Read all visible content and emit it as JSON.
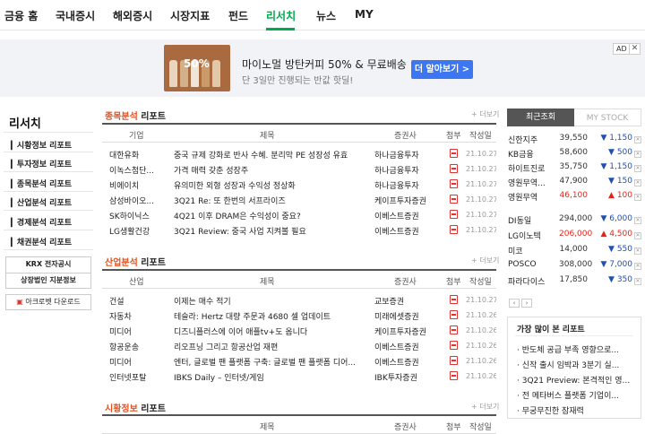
{
  "nav": {
    "tabs": [
      "금융 홈",
      "국내증시",
      "해외증시",
      "시장지표",
      "펀드",
      "리서치",
      "뉴스",
      "MY"
    ]
  },
  "ad": {
    "image_text": "50%",
    "title": "마이노멀 방탄커피 50% & 무료배송",
    "subtitle": "단 3일만 진행되는 반값 핫딜!",
    "button": "더 알아보기 >",
    "badge": "AD",
    "close": "✕"
  },
  "sidebar": {
    "title": "리서치",
    "items": [
      "시황정보 리포트",
      "투자정보 리포트",
      "종목분석 리포트",
      "산업분석 리포트",
      "경제분석 리포트",
      "채권분석 리포트"
    ],
    "links": [
      "KRX 전자공시",
      "상장법인 지분정보",
      "아크로벳 다운로드"
    ]
  },
  "sections": [
    {
      "title_hl": "종목분석",
      "title_rest": " 리포트",
      "more": "+ 더보기",
      "headers": [
        "기업",
        "제목",
        "증권사",
        "첨부",
        "작성일"
      ],
      "rows": [
        [
          "대한유화",
          "중국 규제 강화로 반사 수혜. 분리막 PE 성장성 유효",
          "하나금융투자",
          "21.10.27"
        ],
        [
          "이녹스첨단...",
          "가격 매력 갖춘 성장주",
          "하나금융투자",
          "21.10.27"
        ],
        [
          "비에이치",
          "유의미한 외형 성장과 수익성 정상화",
          "하나금융투자",
          "21.10.27"
        ],
        [
          "삼성바이오...",
          "3Q21 Re: 또 한번의 서프라이즈",
          "케이프투자증권",
          "21.10.27"
        ],
        [
          "SK하이닉스",
          "4Q21 이후 DRAM은 수익성이 중요?",
          "이베스트증권",
          "21.10.27"
        ],
        [
          "LG생활건강",
          "3Q21 Review: 중국 사업 지켜볼 필요",
          "이베스트증권",
          "21.10.27"
        ]
      ]
    },
    {
      "title_hl": "산업분석",
      "title_rest": " 리포트",
      "more": "+ 더보기",
      "headers": [
        "산업",
        "제목",
        "증권사",
        "첨부",
        "작성일"
      ],
      "rows": [
        [
          "건설",
          "이제는 매수 적기",
          "교보증권",
          "21.10.27"
        ],
        [
          "자동차",
          "테슬라: Hertz 대량 주문과 4680 셀 업데이트",
          "미래에셋증권",
          "21.10.26"
        ],
        [
          "미디어",
          "디즈니플러스에 이어 애플tv+도 옵니다",
          "케이프투자증권",
          "21.10.26"
        ],
        [
          "항공운송",
          "리오프닝 그리고 항공산업 재편",
          "이베스트증권",
          "21.10.26"
        ],
        [
          "미디어",
          "엔터, 글로벌 팬 플랫폼 구축: 글로벌 팬 플랫폼 디어...",
          "이베스트증권",
          "21.10.26"
        ],
        [
          "인터넷포탈",
          "IBKS Daily – 인터넷/게임",
          "IBK투자증권",
          "21.10.26"
        ]
      ]
    },
    {
      "title_hl": "시황정보",
      "title_rest": " 리포트",
      "more": "+ 더보기",
      "headers": [
        "",
        "제목",
        "증권사",
        "첨부",
        "작성일"
      ],
      "rows": []
    }
  ],
  "stocks": {
    "tab_recent": "최근조회",
    "tab_mystock": "MY STOCK",
    "items": [
      {
        "name": "신한지주",
        "price": "39,550",
        "change": "▼ 1,150",
        "dir": "dn"
      },
      {
        "name": "KB금융",
        "price": "58,600",
        "change": "▼ 500",
        "dir": "dn"
      },
      {
        "name": "하이트진로",
        "price": "35,750",
        "change": "▼ 1,150",
        "dir": "dn"
      },
      {
        "name": "영원무역...",
        "price": "47,900",
        "change": "▼ 150",
        "dir": "dn"
      },
      {
        "name": "영원무역",
        "price": "46,100",
        "change": "▲ 100",
        "dir": "up"
      },
      {
        "name": "DI동일",
        "price": "294,000",
        "change": "▼ 6,000",
        "dir": "dn"
      },
      {
        "name": "LG이노텍",
        "price": "206,000",
        "change": "▲ 4,500",
        "dir": "up"
      },
      {
        "name": "미코",
        "price": "14,000",
        "change": "▼ 550",
        "dir": "dn"
      },
      {
        "name": "POSCO",
        "price": "308,000",
        "change": "▼ 7,000",
        "dir": "dn"
      },
      {
        "name": "파라다이스",
        "price": "17,850",
        "change": "▼ 350",
        "dir": "dn"
      }
    ],
    "prev": "‹",
    "next": "›"
  },
  "popular": {
    "title": "가장 많이 본 리포트",
    "items": [
      "반도체 공급 부족 영향으로...",
      "신작 출시 임박과 3분기 실...",
      "3Q21 Preview: 본격적인 영...",
      "전 메타버스 플랫폼 기업이...",
      "무궁무진한 잠재력"
    ]
  }
}
